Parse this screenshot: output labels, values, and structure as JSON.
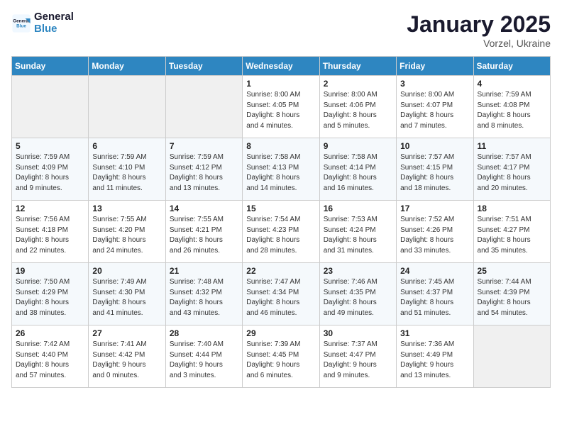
{
  "header": {
    "logo_line1": "General",
    "logo_line2": "Blue",
    "month": "January 2025",
    "location": "Vorzel, Ukraine"
  },
  "weekdays": [
    "Sunday",
    "Monday",
    "Tuesday",
    "Wednesday",
    "Thursday",
    "Friday",
    "Saturday"
  ],
  "weeks": [
    [
      {
        "day": "",
        "info": ""
      },
      {
        "day": "",
        "info": ""
      },
      {
        "day": "",
        "info": ""
      },
      {
        "day": "1",
        "info": "Sunrise: 8:00 AM\nSunset: 4:05 PM\nDaylight: 8 hours\nand 4 minutes."
      },
      {
        "day": "2",
        "info": "Sunrise: 8:00 AM\nSunset: 4:06 PM\nDaylight: 8 hours\nand 5 minutes."
      },
      {
        "day": "3",
        "info": "Sunrise: 8:00 AM\nSunset: 4:07 PM\nDaylight: 8 hours\nand 7 minutes."
      },
      {
        "day": "4",
        "info": "Sunrise: 7:59 AM\nSunset: 4:08 PM\nDaylight: 8 hours\nand 8 minutes."
      }
    ],
    [
      {
        "day": "5",
        "info": "Sunrise: 7:59 AM\nSunset: 4:09 PM\nDaylight: 8 hours\nand 9 minutes."
      },
      {
        "day": "6",
        "info": "Sunrise: 7:59 AM\nSunset: 4:10 PM\nDaylight: 8 hours\nand 11 minutes."
      },
      {
        "day": "7",
        "info": "Sunrise: 7:59 AM\nSunset: 4:12 PM\nDaylight: 8 hours\nand 13 minutes."
      },
      {
        "day": "8",
        "info": "Sunrise: 7:58 AM\nSunset: 4:13 PM\nDaylight: 8 hours\nand 14 minutes."
      },
      {
        "day": "9",
        "info": "Sunrise: 7:58 AM\nSunset: 4:14 PM\nDaylight: 8 hours\nand 16 minutes."
      },
      {
        "day": "10",
        "info": "Sunrise: 7:57 AM\nSunset: 4:15 PM\nDaylight: 8 hours\nand 18 minutes."
      },
      {
        "day": "11",
        "info": "Sunrise: 7:57 AM\nSunset: 4:17 PM\nDaylight: 8 hours\nand 20 minutes."
      }
    ],
    [
      {
        "day": "12",
        "info": "Sunrise: 7:56 AM\nSunset: 4:18 PM\nDaylight: 8 hours\nand 22 minutes."
      },
      {
        "day": "13",
        "info": "Sunrise: 7:55 AM\nSunset: 4:20 PM\nDaylight: 8 hours\nand 24 minutes."
      },
      {
        "day": "14",
        "info": "Sunrise: 7:55 AM\nSunset: 4:21 PM\nDaylight: 8 hours\nand 26 minutes."
      },
      {
        "day": "15",
        "info": "Sunrise: 7:54 AM\nSunset: 4:23 PM\nDaylight: 8 hours\nand 28 minutes."
      },
      {
        "day": "16",
        "info": "Sunrise: 7:53 AM\nSunset: 4:24 PM\nDaylight: 8 hours\nand 31 minutes."
      },
      {
        "day": "17",
        "info": "Sunrise: 7:52 AM\nSunset: 4:26 PM\nDaylight: 8 hours\nand 33 minutes."
      },
      {
        "day": "18",
        "info": "Sunrise: 7:51 AM\nSunset: 4:27 PM\nDaylight: 8 hours\nand 35 minutes."
      }
    ],
    [
      {
        "day": "19",
        "info": "Sunrise: 7:50 AM\nSunset: 4:29 PM\nDaylight: 8 hours\nand 38 minutes."
      },
      {
        "day": "20",
        "info": "Sunrise: 7:49 AM\nSunset: 4:30 PM\nDaylight: 8 hours\nand 41 minutes."
      },
      {
        "day": "21",
        "info": "Sunrise: 7:48 AM\nSunset: 4:32 PM\nDaylight: 8 hours\nand 43 minutes."
      },
      {
        "day": "22",
        "info": "Sunrise: 7:47 AM\nSunset: 4:34 PM\nDaylight: 8 hours\nand 46 minutes."
      },
      {
        "day": "23",
        "info": "Sunrise: 7:46 AM\nSunset: 4:35 PM\nDaylight: 8 hours\nand 49 minutes."
      },
      {
        "day": "24",
        "info": "Sunrise: 7:45 AM\nSunset: 4:37 PM\nDaylight: 8 hours\nand 51 minutes."
      },
      {
        "day": "25",
        "info": "Sunrise: 7:44 AM\nSunset: 4:39 PM\nDaylight: 8 hours\nand 54 minutes."
      }
    ],
    [
      {
        "day": "26",
        "info": "Sunrise: 7:42 AM\nSunset: 4:40 PM\nDaylight: 8 hours\nand 57 minutes."
      },
      {
        "day": "27",
        "info": "Sunrise: 7:41 AM\nSunset: 4:42 PM\nDaylight: 9 hours\nand 0 minutes."
      },
      {
        "day": "28",
        "info": "Sunrise: 7:40 AM\nSunset: 4:44 PM\nDaylight: 9 hours\nand 3 minutes."
      },
      {
        "day": "29",
        "info": "Sunrise: 7:39 AM\nSunset: 4:45 PM\nDaylight: 9 hours\nand 6 minutes."
      },
      {
        "day": "30",
        "info": "Sunrise: 7:37 AM\nSunset: 4:47 PM\nDaylight: 9 hours\nand 9 minutes."
      },
      {
        "day": "31",
        "info": "Sunrise: 7:36 AM\nSunset: 4:49 PM\nDaylight: 9 hours\nand 13 minutes."
      },
      {
        "day": "",
        "info": ""
      }
    ]
  ]
}
